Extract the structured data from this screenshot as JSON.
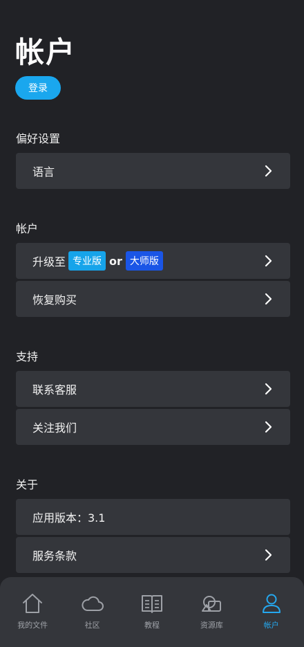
{
  "header": {
    "title": "帐户",
    "login_label": "登录"
  },
  "sections": {
    "preferences": {
      "title": "偏好设置",
      "language_label": "语言"
    },
    "account": {
      "title": "帐户",
      "upgrade_prefix": "升级至",
      "pro_badge": "专业版",
      "or_text": "or",
      "master_badge": "大师版",
      "restore_label": "恢复购买"
    },
    "support": {
      "title": "支持",
      "contact_label": "联系客服",
      "follow_label": "关注我们"
    },
    "about": {
      "title": "关于",
      "version_label": "应用版本：3.1",
      "terms_label": "服务条款"
    }
  },
  "tabbar": {
    "items": [
      {
        "label": "我的文件",
        "icon": "home-icon"
      },
      {
        "label": "社区",
        "icon": "cloud-icon"
      },
      {
        "label": "教程",
        "icon": "book-icon"
      },
      {
        "label": "资源库",
        "icon": "shapes-icon"
      },
      {
        "label": "帐户",
        "icon": "user-icon"
      }
    ],
    "active_index": 4
  },
  "colors": {
    "background": "#212226",
    "card": "#34363b",
    "accent": "#1aa7ee",
    "master_badge": "#1a55e6",
    "tab_inactive": "#9ea1a7"
  }
}
